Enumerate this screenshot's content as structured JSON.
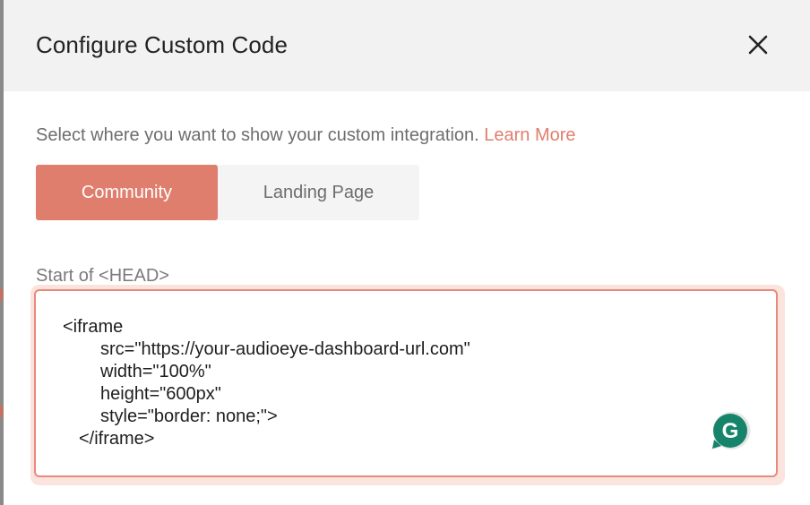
{
  "dialog": {
    "title": "Configure Custom Code",
    "close_icon": "close-icon"
  },
  "intro": {
    "text": "Select where you want to show your custom integration.",
    "learn_more": "Learn More"
  },
  "tabs": [
    {
      "label": "Community",
      "selected": true
    },
    {
      "label": "Landing Page",
      "selected": false
    }
  ],
  "head_field": {
    "label": "Start of <HEAD>",
    "lines": [
      "<iframe",
      "src=\"https://your-audioeye-dashboard-url.com\"",
      "width=\"100%\"",
      "height=\"600px\"",
      "style=\"border: none;\">",
      "</iframe>"
    ]
  },
  "grammarly": {
    "icon": "grammarly-icon",
    "letter": "G"
  },
  "colors": {
    "accent": "#e07e6e",
    "header_bg": "#f2f2f2",
    "tab_bg": "#f4f4f4",
    "field_border": "#e98a7b",
    "grammarly_green": "#15846a"
  }
}
